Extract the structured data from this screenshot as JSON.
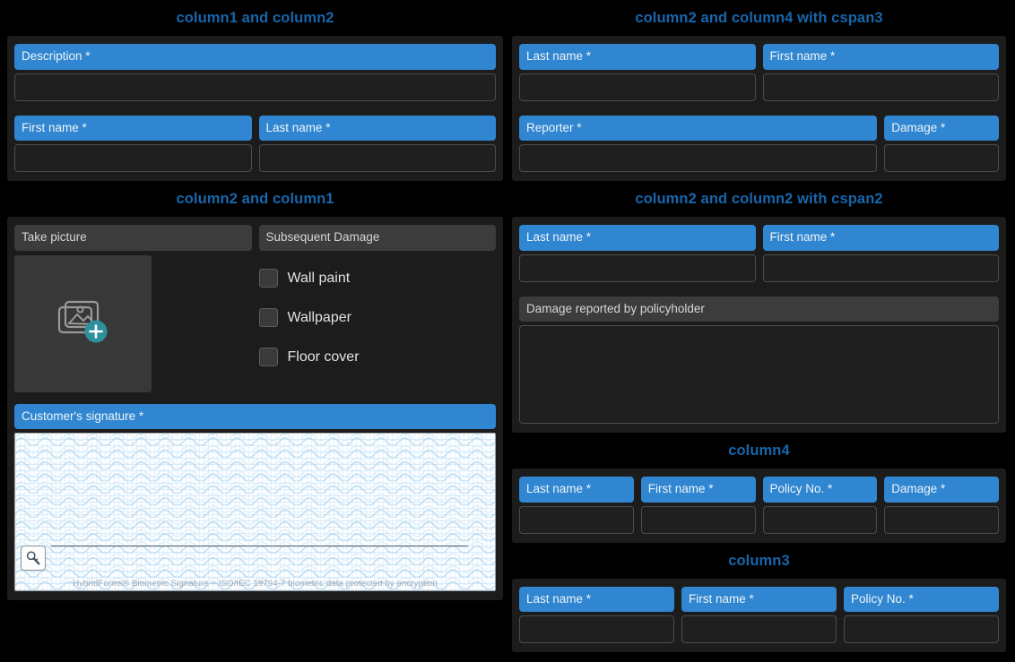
{
  "colors": {
    "page_bg": "#000000",
    "panel_bg": "#1c1c1c",
    "heading": "#1766ab",
    "label_required": "#3086d0",
    "label_plain": "#3c3c3c",
    "input_bg": "#1f1f1f",
    "input_border": "#4c4c4c",
    "accent_teal": "#2f8f9d"
  },
  "sections": {
    "col1_col2": {
      "title": "column1 and column2",
      "row1": [
        {
          "label": "Description *",
          "required": true,
          "value": "",
          "span": 1
        }
      ],
      "row2": [
        {
          "label": "First name *",
          "required": true,
          "value": "",
          "span": 1
        },
        {
          "label": "Last name *",
          "required": true,
          "value": "",
          "span": 1
        }
      ]
    },
    "col2_col4_cspan3": {
      "title": "column2 and column4 with cspan3",
      "row1": [
        {
          "label": "Last name *",
          "required": true,
          "value": "",
          "span": 1
        },
        {
          "label": "First name *",
          "required": true,
          "value": "",
          "span": 1
        }
      ],
      "row2": [
        {
          "label": "Reporter *",
          "required": true,
          "value": "",
          "span": 3
        },
        {
          "label": "Damage *",
          "required": true,
          "value": "",
          "span": 1
        }
      ]
    },
    "col2_col1": {
      "title": "column2 and column1",
      "picture_label": "Take picture",
      "picture_icon": "add-photo-icon",
      "checkbox_group_label": "Subsequent Damage",
      "checkboxes": [
        {
          "label": "Wall paint",
          "checked": false
        },
        {
          "label": "Wallpaper",
          "checked": false
        },
        {
          "label": "Floor cover",
          "checked": false
        }
      ],
      "signature_label": "Customer's signature *",
      "signature_key_icon": "signature-key-icon",
      "signature_note": "HybridForms® Biometric Signature  –  ISO/IEC 19794-7 biometric data protected by encryption"
    },
    "col2_col2_cspan2": {
      "title": "column2 and column2 with cspan2",
      "row1": [
        {
          "label": "Last name *",
          "required": true,
          "value": "",
          "span": 1
        },
        {
          "label": "First name *",
          "required": true,
          "value": "",
          "span": 1
        }
      ],
      "row2": [
        {
          "label": "Damage reported by policyholder",
          "required": false,
          "value": "",
          "span": 2
        }
      ]
    },
    "col4": {
      "title": "column4",
      "row1": [
        {
          "label": "Last name *",
          "required": true,
          "value": "",
          "span": 1
        },
        {
          "label": "First name *",
          "required": true,
          "value": "",
          "span": 1
        },
        {
          "label": "Policy No. *",
          "required": true,
          "value": "",
          "span": 1
        },
        {
          "label": "Damage *",
          "required": true,
          "value": "",
          "span": 1
        }
      ]
    },
    "col3": {
      "title": "column3",
      "row1": [
        {
          "label": "Last name *",
          "required": true,
          "value": "",
          "span": 1
        },
        {
          "label": "First name *",
          "required": true,
          "value": "",
          "span": 1
        },
        {
          "label": "Policy No. *",
          "required": true,
          "value": "",
          "span": 1
        }
      ]
    }
  }
}
